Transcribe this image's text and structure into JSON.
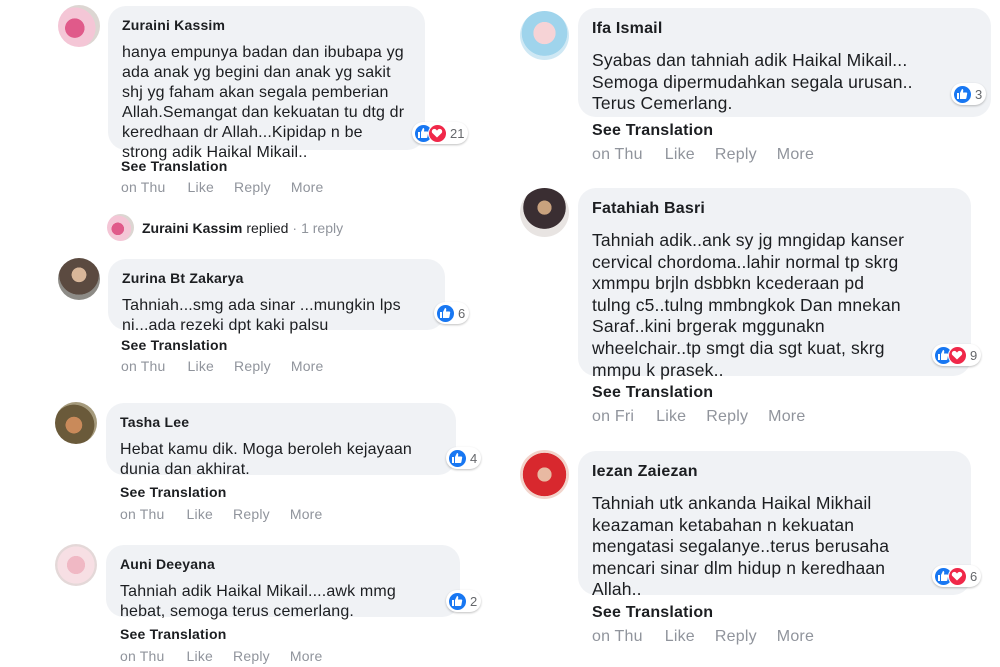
{
  "left": [
    {
      "author": "Zuraini Kassim",
      "text": [
        "hanya empunya badan dan ibubapa yg",
        "ada anak yg begini dan anak yg sakit",
        "shj yg faham akan segala pemberian",
        "Allah.Semangat dan kekuatan tu dtg dr",
        "keredhaan dr Allah...Kipidap n be",
        "strong adik Haikal Mikail.."
      ],
      "reactions": {
        "icons": [
          "like-icon",
          "love-icon"
        ],
        "count": "21"
      },
      "see_translation": "See Translation",
      "time": "on Thu",
      "like": "Like",
      "reply": "Reply",
      "more": "More"
    },
    {
      "author": "Zurina Bt Zakarya",
      "text": [
        "Tahniah...smg ada sinar ...mungkin lps",
        "ni...ada rezeki dpt kaki palsu"
      ],
      "reactions": {
        "icons": [
          "like-icon"
        ],
        "count": "6"
      },
      "see_translation": "See Translation",
      "time": "on Thu",
      "like": "Like",
      "reply": "Reply",
      "more": "More"
    },
    {
      "author": "Tasha Lee",
      "text": [
        "Hebat kamu dik. Moga beroleh kejayaan",
        "dunia dan akhirat."
      ],
      "reactions": {
        "icons": [
          "like-icon"
        ],
        "count": "4"
      },
      "see_translation": "See Translation",
      "time": "on Thu",
      "like": "Like",
      "reply": "Reply",
      "more": "More"
    },
    {
      "author": "Auni Deeyana",
      "text": [
        "Tahniah adik Haikal Mikail....awk mmg",
        "hebat, semoga terus cemerlang."
      ],
      "reactions": {
        "icons": [
          "like-icon"
        ],
        "count": "2"
      },
      "see_translation": "See Translation",
      "time": "on Thu",
      "like": "Like",
      "reply": "Reply",
      "more": "More"
    }
  ],
  "reply_summary": {
    "name": "Zuraini Kassim",
    "verb": "replied",
    "dot": "·",
    "count": "1 reply"
  },
  "right": [
    {
      "author": "Ifa Ismail",
      "text": [
        "Syabas dan tahniah adik Haikal Mikail...",
        "Semoga dipermudahkan segala urusan..",
        "Terus Cemerlang."
      ],
      "reactions": {
        "icons": [
          "like-icon"
        ],
        "count": "3"
      },
      "see_translation": "See Translation",
      "time": "on Thu",
      "like": "Like",
      "reply": "Reply",
      "more": "More"
    },
    {
      "author": "Fatahiah Basri",
      "text": [
        "Tahniah adik..ank sy jg mngidap kanser",
        "cervical chordoma..lahir normal tp skrg",
        "xmmpu brjln dsbbkn kcederaan pd",
        "tulng c5..tulng mmbngkok Dan mnekan",
        "Saraf..kini brgerak mggunakn",
        "wheelchair..tp smgt dia sgt kuat, skrg",
        "mmpu k prasek.."
      ],
      "reactions": {
        "icons": [
          "like-icon",
          "love-icon"
        ],
        "count": "9"
      },
      "see_translation": "See Translation",
      "time": "on Fri",
      "like": "Like",
      "reply": "Reply",
      "more": "More"
    },
    {
      "author": "Iezan Zaiezan",
      "text": [
        "Tahniah utk ankanda Haikal Mikhail",
        "keazaman ketabahan n kekuatan",
        "mengatasi segalanye..terus berusaha",
        "mencari sinar dlm hidup n keredhaan",
        "Allah.."
      ],
      "reactions": {
        "icons": [
          "like-icon",
          "love-icon"
        ],
        "count": "6"
      },
      "see_translation": "See Translation",
      "time": "on Thu",
      "like": "Like",
      "reply": "Reply",
      "more": "More"
    }
  ],
  "colors": {
    "bubble": "#f0f2f5",
    "like": "#1877f2",
    "love": "#f02849",
    "meta": "#90949c"
  }
}
